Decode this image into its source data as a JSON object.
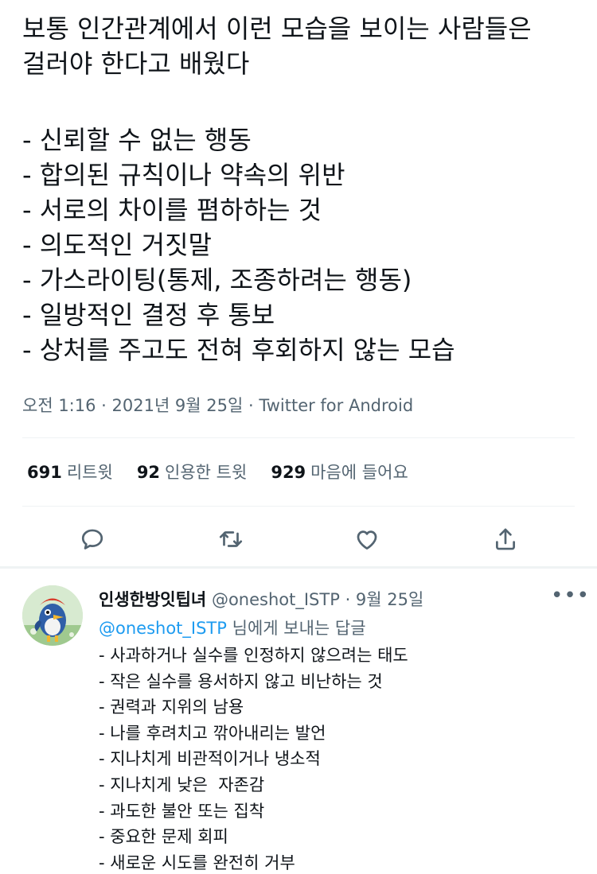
{
  "tweet": {
    "lines": [
      "보통 인간관계에서 이런 모습을 보이는 사람들은",
      "걸러야 한다고 배웠다",
      "- 신뢰할 수 없는 행동",
      "- 합의된 규칙이나 약속의 위반",
      "- 서로의 차이를 폄하하는 것",
      "- 의도적인 거짓말",
      "- 가스라이팅(통제, 조종하려는 행동)",
      "- 일방적인 결정 후 통보",
      "- 상처를 주고도 전혀 후회하지 않는 모습"
    ],
    "meta": "오전 1:16 · 2021년 9월 25일 · Twitter for Android"
  },
  "stats": {
    "retweets_count": "691",
    "retweets_label": "리트윗",
    "quotes_count": "92",
    "quotes_label": "인용한 트윗",
    "likes_count": "929",
    "likes_label": "마음에 들어요"
  },
  "actions": {
    "icons": [
      "reply-icon",
      "retweet-icon",
      "like-icon",
      "share-icon"
    ],
    "icon_color": "#536471"
  },
  "reply": {
    "name": "인생한방잇팁녀",
    "handle": "@oneshot_ISTP",
    "date": "9월 25일",
    "replying_handle": "@oneshot_ISTP",
    "replying_suffix": "님에게 보내는 답글",
    "lines": [
      "- 사과하거나 실수를 인정하지 않으려는 태도",
      "- 작은 실수를 용서하지 않고 비난하는 것",
      "- 권력과 지위의 남용",
      "- 나를 후려치고 깎아내리는 발언",
      "- 지나치게 비관적이거나 냉소적",
      "- 지나치게 낮은  자존감",
      "- 과도한 불안 또는 집착",
      "- 중요한 문제 회피",
      "- 새로운 시도를 완전히 거부"
    ]
  },
  "colors": {
    "text": "#0f1419",
    "secondary": "#536471",
    "link": "#1d9bf0",
    "divider": "#eff3f4"
  }
}
